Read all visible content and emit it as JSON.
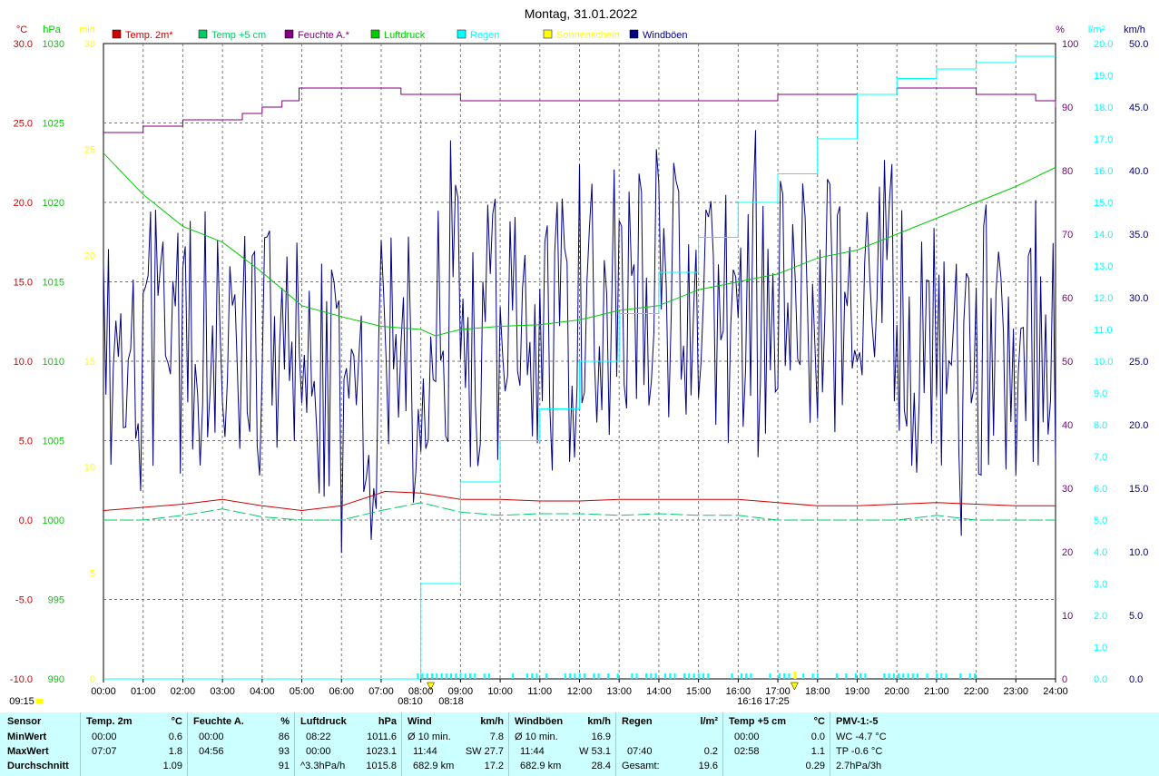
{
  "title": "Montag, 31.01.2022",
  "colors": {
    "temp2m": "#cc0000",
    "temp5cm": "#00cc66",
    "feuchte": "#800080",
    "luftdruck": "#00cc00",
    "regen": "#00ffff",
    "sonne": "#ffff00",
    "wind": "#000080",
    "summary_bg": "#ccffff"
  },
  "axes": {
    "left_celsius": {
      "unit": "°C",
      "ticks": [
        "30.0",
        "25.0",
        "20.0",
        "15.0",
        "10.0",
        "5.0",
        "0.0",
        "-5.0",
        "-10.0"
      ]
    },
    "left_hpa": {
      "unit": "hPa",
      "ticks": [
        "1030",
        "1025",
        "1020",
        "1015",
        "1010",
        "1005",
        "1000",
        "995",
        "990"
      ]
    },
    "left_min": {
      "unit": "min",
      "ticks": [
        "30",
        "25",
        "20",
        "15",
        "10",
        "5",
        "0"
      ]
    },
    "right_percent": {
      "unit": "%",
      "ticks": [
        "100",
        "90",
        "80",
        "70",
        "60",
        "50",
        "40",
        "30",
        "20",
        "10",
        "0"
      ]
    },
    "right_rain": {
      "unit": "l/m²",
      "ticks": [
        "20.0",
        "19.0",
        "18.0",
        "17.0",
        "16.0",
        "15.0",
        "14.0",
        "13.0",
        "12.0",
        "11.0",
        "10.0",
        "9.0",
        "8.0",
        "7.0",
        "6.0",
        "5.0",
        "4.0",
        "3.0",
        "2.0",
        "1.0",
        "0.0"
      ]
    },
    "right_wind": {
      "unit": "km/h",
      "ticks": [
        "50.0",
        "45.0",
        "40.0",
        "35.0",
        "30.0",
        "25.0",
        "20.0",
        "15.0",
        "10.0",
        "5.0",
        "0.0"
      ]
    },
    "x_ticks": [
      "00:00",
      "01:00",
      "02:00",
      "03:00",
      "04:00",
      "05:00",
      "06:00",
      "07:00",
      "08:00",
      "09:00",
      "10:00",
      "11:00",
      "12:00",
      "13:00",
      "14:00",
      "15:00",
      "16:00",
      "17:00",
      "18:00",
      "19:00",
      "20:00",
      "21:00",
      "22:00",
      "23:00",
      "24:00"
    ]
  },
  "legend": [
    {
      "label": "Temp. 2m*",
      "color": "#cc0000"
    },
    {
      "label": "Temp +5 cm",
      "color": "#00cc66"
    },
    {
      "label": "Feuchte A.*",
      "color": "#800080"
    },
    {
      "label": "Luftdruck",
      "color": "#00cc00"
    },
    {
      "label": "Regen",
      "color": "#00ffff"
    },
    {
      "label": "Sonnenschein",
      "color": "#ffff00"
    },
    {
      "label": "Windböen",
      "color": "#000080"
    }
  ],
  "annotations": {
    "sunrise": "08:10",
    "sunrise2": "08:18",
    "sunset": "17:25",
    "sunset_mark": "16:16",
    "bottom_left": "09:15"
  },
  "chart_data": {
    "type": "line",
    "title": "Montag, 31.01.2022",
    "x_range_hours": [
      0,
      24
    ],
    "series": [
      {
        "name": "Temp. 2m*",
        "axis": "°C",
        "ylim": [
          -10,
          30
        ],
        "points": [
          [
            0,
            0.6
          ],
          [
            1,
            0.8
          ],
          [
            2,
            1.0
          ],
          [
            3,
            1.3
          ],
          [
            4,
            0.9
          ],
          [
            5,
            0.6
          ],
          [
            6,
            0.9
          ],
          [
            7.1,
            1.8
          ],
          [
            8,
            1.7
          ],
          [
            9,
            1.3
          ],
          [
            10,
            1.3
          ],
          [
            11,
            1.2
          ],
          [
            12,
            1.2
          ],
          [
            13,
            1.3
          ],
          [
            14,
            1.3
          ],
          [
            15,
            1.3
          ],
          [
            16,
            1.3
          ],
          [
            17,
            1.1
          ],
          [
            18,
            0.9
          ],
          [
            19,
            0.9
          ],
          [
            20,
            1.0
          ],
          [
            21,
            1.1
          ],
          [
            22,
            1.0
          ],
          [
            23,
            0.9
          ],
          [
            24,
            0.9
          ]
        ]
      },
      {
        "name": "Temp +5 cm",
        "axis": "°C",
        "ylim": [
          -10,
          30
        ],
        "points": [
          [
            0,
            0.0
          ],
          [
            1,
            0.0
          ],
          [
            2,
            0.3
          ],
          [
            3,
            0.7
          ],
          [
            4,
            0.2
          ],
          [
            5,
            0.0
          ],
          [
            6,
            0.0
          ],
          [
            7,
            0.6
          ],
          [
            8,
            1.1
          ],
          [
            9,
            0.5
          ],
          [
            10,
            0.3
          ],
          [
            11,
            0.4
          ],
          [
            12,
            0.4
          ],
          [
            13,
            0.3
          ],
          [
            14,
            0.4
          ],
          [
            15,
            0.3
          ],
          [
            16,
            0.3
          ],
          [
            17,
            0.0
          ],
          [
            18,
            0.0
          ],
          [
            19,
            0.0
          ],
          [
            20,
            0.0
          ],
          [
            21,
            0.3
          ],
          [
            22,
            0.0
          ],
          [
            23,
            0.0
          ],
          [
            24,
            0.0
          ]
        ]
      },
      {
        "name": "Feuchte A.*",
        "axis": "%",
        "ylim": [
          0,
          100
        ],
        "points": [
          [
            0,
            86
          ],
          [
            0.7,
            86
          ],
          [
            1,
            87
          ],
          [
            2,
            88
          ],
          [
            3,
            88
          ],
          [
            3.5,
            89
          ],
          [
            4,
            90
          ],
          [
            4.5,
            91
          ],
          [
            4.93,
            93
          ],
          [
            6,
            93
          ],
          [
            7,
            93
          ],
          [
            7.5,
            92
          ],
          [
            8,
            92
          ],
          [
            9,
            91
          ],
          [
            10,
            91
          ],
          [
            11,
            91
          ],
          [
            12,
            91
          ],
          [
            13,
            91
          ],
          [
            14,
            91
          ],
          [
            15,
            91
          ],
          [
            16,
            91
          ],
          [
            17,
            92
          ],
          [
            18,
            92
          ],
          [
            19,
            92
          ],
          [
            20,
            93
          ],
          [
            21,
            93
          ],
          [
            22,
            92
          ],
          [
            23,
            92
          ],
          [
            23.5,
            91
          ],
          [
            24,
            90
          ]
        ]
      },
      {
        "name": "Luftdruck",
        "axis": "hPa",
        "ylim": [
          990,
          1030
        ],
        "points": [
          [
            0,
            1023.1
          ],
          [
            1,
            1020.5
          ],
          [
            2,
            1018.5
          ],
          [
            3,
            1017.5
          ],
          [
            4,
            1015.6
          ],
          [
            5,
            1013.5
          ],
          [
            6,
            1012.8
          ],
          [
            7,
            1012.2
          ],
          [
            8,
            1012.0
          ],
          [
            8.37,
            1011.6
          ],
          [
            9,
            1012.0
          ],
          [
            10,
            1012.2
          ],
          [
            11,
            1012.3
          ],
          [
            12,
            1012.6
          ],
          [
            13,
            1013.2
          ],
          [
            14,
            1013.5
          ],
          [
            15,
            1014.5
          ],
          [
            16,
            1015.0
          ],
          [
            17,
            1015.5
          ],
          [
            18,
            1016.5
          ],
          [
            19,
            1017.0
          ],
          [
            20,
            1018.0
          ],
          [
            21,
            1019.0
          ],
          [
            22,
            1020.0
          ],
          [
            23,
            1021.0
          ],
          [
            24,
            1022.2
          ]
        ]
      },
      {
        "name": "Regen",
        "axis": "l/m²",
        "ylim": [
          0,
          20
        ],
        "points": [
          [
            0,
            0
          ],
          [
            7.67,
            0
          ],
          [
            8,
            3.0
          ],
          [
            9,
            6.2
          ],
          [
            10,
            7.5
          ],
          [
            11,
            8.5
          ],
          [
            12,
            10.0
          ],
          [
            13,
            11.5
          ],
          [
            14,
            12.8
          ],
          [
            15,
            13.9
          ],
          [
            16,
            15.0
          ],
          [
            17,
            15.9
          ],
          [
            18,
            17.0
          ],
          [
            19,
            18.4
          ],
          [
            20,
            18.9
          ],
          [
            21,
            19.2
          ],
          [
            22,
            19.4
          ],
          [
            23,
            19.6
          ],
          [
            24,
            19.6
          ]
        ]
      },
      {
        "name": "Windböen",
        "axis": "km/h",
        "ylim": [
          0,
          50
        ],
        "hourly_mean": [
          24,
          26,
          27,
          25,
          26,
          22,
          20,
          24,
          28,
          27,
          26,
          27,
          30,
          31,
          30,
          28,
          28,
          29,
          30,
          30,
          26,
          22,
          27,
          27
        ],
        "max": 53.1
      }
    ]
  },
  "summary": {
    "row_labels": {
      "head": "Sensor",
      "min": "MinWert",
      "max": "MaxWert",
      "avg": "Durchschnitt"
    },
    "temp2m": {
      "head": "Temp. 2m",
      "unit": "°C",
      "min_time": "00:00",
      "min_val": "0.6",
      "max_time": "07:07",
      "max_val": "1.8",
      "avg": "1.09"
    },
    "feuchte": {
      "head": "Feuchte A.",
      "unit": "%",
      "min_time": "00:00",
      "min_val": "86",
      "max_time": "04:56",
      "max_val": "93",
      "avg": "91"
    },
    "luftdruck": {
      "head": "Luftdruck",
      "unit": "hPa",
      "min_time": "08:22",
      "min_val": "1011.6",
      "max_time": "00:00",
      "max_val": "1023.1",
      "avg_label": "^3.3hPa/h",
      "avg": "1015.8"
    },
    "wind": {
      "head": "Wind",
      "unit": "km/h",
      "min_time": "Ø 10 min.",
      "min_val": "7.8",
      "max_time": "11:44",
      "max_val": "SW 27.7",
      "avg_label": "682.9 km",
      "avg": "17.2"
    },
    "boeen": {
      "head": "Windböen",
      "unit": "km/h",
      "min_time": "Ø 10 min.",
      "min_val": "16.9",
      "max_time": "11:44",
      "max_val": "W 53.1",
      "avg_label": "682.9 km",
      "avg": "28.4"
    },
    "regen": {
      "head": "Regen",
      "unit": "l/m²",
      "max_time": "07:40",
      "max_val": "0.2",
      "avg_label": "Gesamt:",
      "avg": "19.6"
    },
    "temp5cm": {
      "head": "Temp +5 cm",
      "unit": "°C",
      "min_time": "00:00",
      "min_val": "0.0",
      "max_time": "02:58",
      "max_val": "1.1",
      "avg": "0.29"
    },
    "pmv": {
      "head": "PMV-1:-5",
      "min_val": "WC -4.7 °C",
      "max_val": "TP -0.6 °C",
      "avg": "2.7hPa/3h"
    }
  }
}
